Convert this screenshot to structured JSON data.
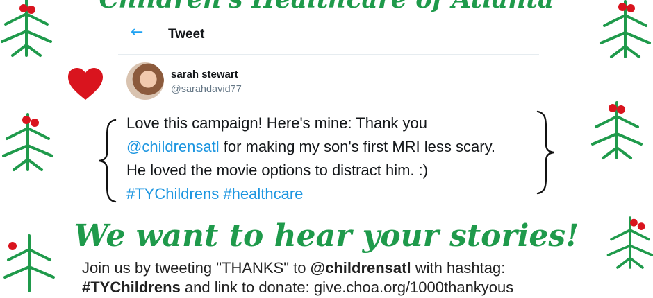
{
  "banner": {
    "title": "Children's Healthcare of Atlanta"
  },
  "tweet": {
    "header_title": "Tweet",
    "user_name": "sarah stewart",
    "user_handle": "@sarahdavid77",
    "body_line1": "Love this campaign! Here's mine: Thank you",
    "body_mention": "@childrensatl",
    "body_line2": " for making my son's first MRI less scary.",
    "body_line3": "He loved the movie options to distract him. :)",
    "hashtag1": "#TYChildrens",
    "hashtag2": "#healthcare"
  },
  "cta": {
    "headline": "We want to hear your stories!"
  },
  "join": {
    "prefix": "Join us by tweeting \"THANKS\" to ",
    "mention": "@childrensatl",
    "suffix": " with hashtag:",
    "line2_hashtag": "#TYChildrens",
    "line2_rest": " and link to donate: give.choa.org/1000thankyous"
  },
  "colors": {
    "accent_green": "#1f9a4b",
    "link_blue": "#1b95e0",
    "heart_red": "#d9141e"
  }
}
